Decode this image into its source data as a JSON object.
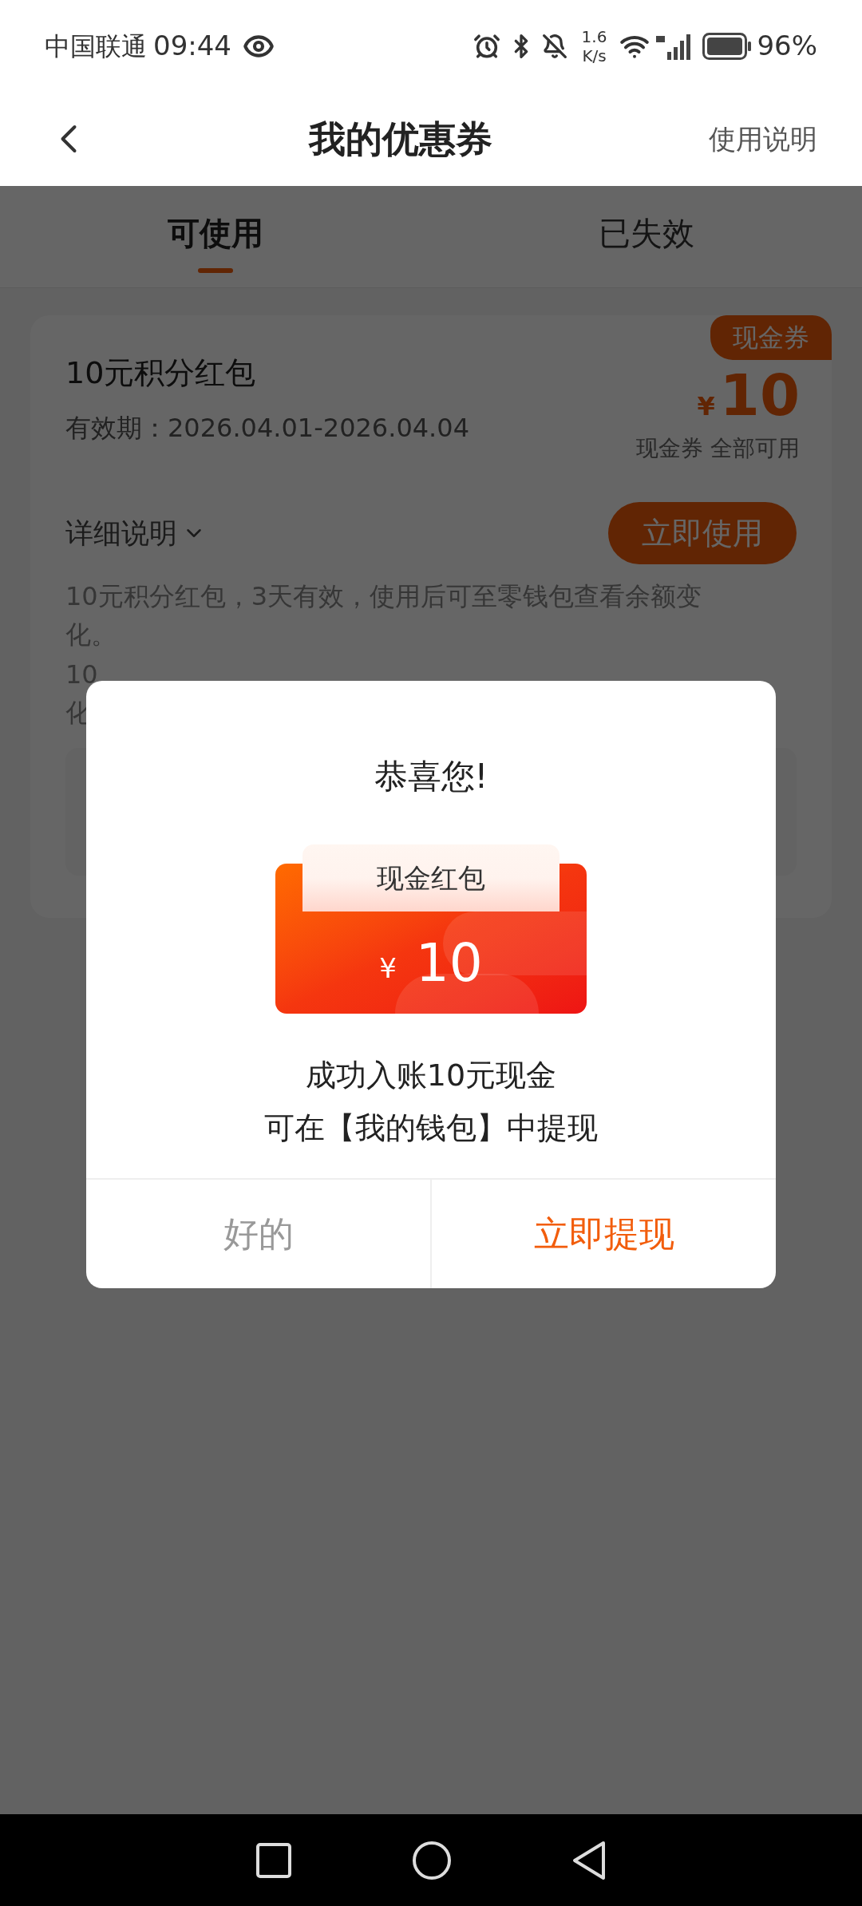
{
  "status_bar": {
    "carrier": "中国联通",
    "time": "09:44",
    "speed_value": "1.6",
    "speed_unit": "K/s",
    "battery": "96%"
  },
  "header": {
    "title": "我的优惠券",
    "action": "使用说明"
  },
  "tabs": [
    {
      "label": "可使用",
      "selected": true
    },
    {
      "label": "已失效",
      "selected": false
    }
  ],
  "coupon": {
    "title": "10元积分红包",
    "validity": "有效期：2026.04.01-2026.04.04",
    "badge": "现金券",
    "currency": "¥",
    "amount": "10",
    "scope": "现金券 全部可用",
    "details_toggle": "详细说明",
    "use_button": "立即使用",
    "description": "10元积分红包，3天有效，使用后可至零钱包查看余额变化。",
    "description_fragment": [
      "10",
      "化"
    ]
  },
  "dialog": {
    "title": "恭喜您!",
    "envelope": {
      "label": "现金红包",
      "currency": "¥",
      "amount": "10"
    },
    "message": [
      "成功入账10元现金",
      "可在【我的钱包】中提现"
    ],
    "buttons": [
      {
        "label": "好的",
        "kind": "secondary"
      },
      {
        "label": "立即提现",
        "kind": "primary"
      }
    ]
  }
}
